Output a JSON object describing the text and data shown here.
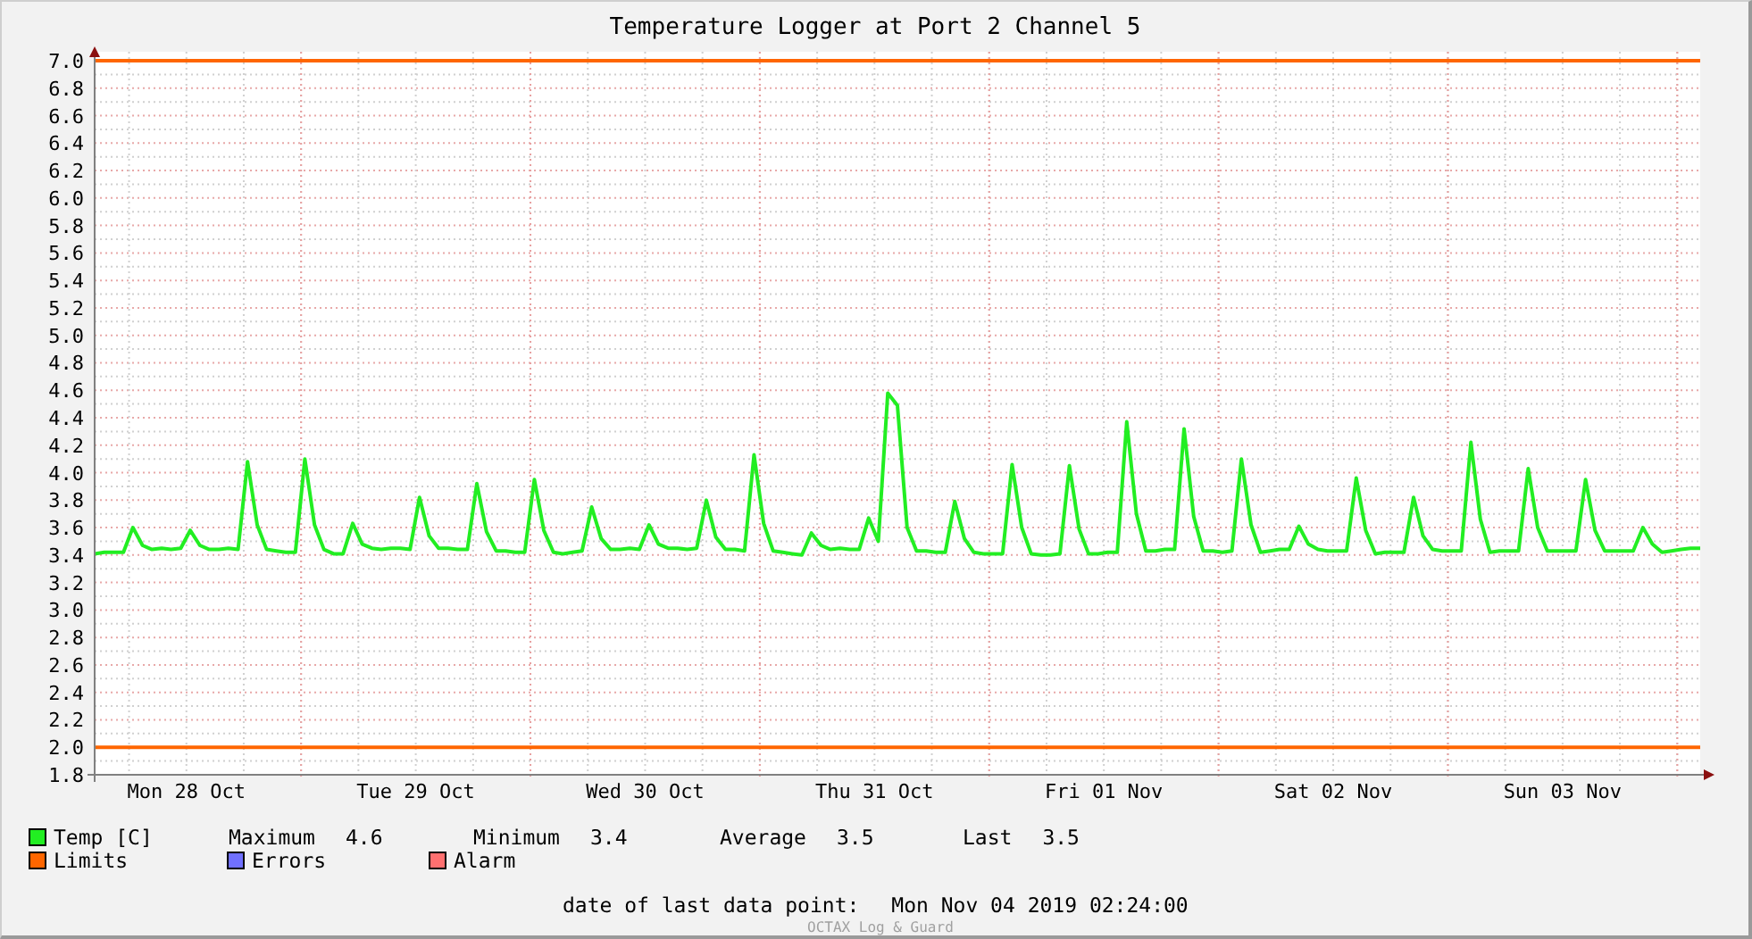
{
  "chart_data": {
    "type": "line",
    "title": "Temperature Logger at Port 2 Channel 5",
    "ylim": [
      1.8,
      7.0
    ],
    "categories": [
      null,
      null,
      null,
      null,
      null,
      null,
      null,
      null,
      null,
      null,
      "Mon 28 Oct",
      null,
      null,
      null,
      null,
      null,
      null,
      null,
      null,
      null,
      null,
      null,
      null,
      null,
      null,
      null,
      null,
      null,
      null,
      null,
      null,
      null,
      null,
      null,
      "Tue 29 Oct",
      null,
      null,
      null,
      null,
      null,
      null,
      null,
      null,
      null,
      null,
      null,
      null,
      null,
      null,
      null,
      null,
      null,
      null,
      null,
      null,
      null,
      null,
      null,
      "Wed 30 Oct",
      null,
      null,
      null,
      null,
      null,
      null,
      null,
      null,
      null,
      null,
      null,
      null,
      null,
      null,
      null,
      null,
      null,
      null,
      null,
      null,
      null,
      null,
      null,
      "Thu 31 Oct",
      null,
      null,
      null,
      null,
      null,
      null,
      null,
      null,
      null,
      null,
      null,
      null,
      null,
      null,
      null,
      null,
      null,
      null,
      null,
      null,
      null,
      null,
      null,
      "Fri 01 Nov",
      null,
      null,
      null,
      null,
      null,
      null,
      null,
      null,
      null,
      null,
      null,
      null,
      null,
      null,
      null,
      null,
      null,
      null,
      null,
      null,
      null,
      null,
      null,
      "Sat 02 Nov",
      null,
      null,
      null,
      null,
      null,
      null,
      null,
      null,
      null,
      null,
      null,
      null,
      null,
      null,
      null,
      null,
      null,
      null,
      null,
      null,
      null,
      null,
      null,
      "Sun 03 Nov",
      null,
      null,
      null,
      null,
      null,
      null,
      null,
      null,
      null,
      null,
      null,
      null,
      null,
      null
    ],
    "yticks": [
      {
        "value": 1.8,
        "label": "1.8"
      },
      {
        "value": 2,
        "label": "2.0"
      },
      {
        "value": 2.2,
        "label": "2.2"
      },
      {
        "value": 2.4,
        "label": "2.4"
      },
      {
        "value": 2.6,
        "label": "2.6"
      },
      {
        "value": 2.8,
        "label": "2.8"
      },
      {
        "value": 3,
        "label": "3.0"
      },
      {
        "value": 3.2,
        "label": "3.2"
      },
      {
        "value": 3.4,
        "label": "3.4"
      },
      {
        "value": 3.6,
        "label": "3.6"
      },
      {
        "value": 3.8,
        "label": "3.8"
      },
      {
        "value": 4,
        "label": "4.0"
      },
      {
        "value": 4.2,
        "label": "4.2"
      },
      {
        "value": 4.4,
        "label": "4.4"
      },
      {
        "value": 4.6,
        "label": "4.6"
      },
      {
        "value": 4.8,
        "label": "4.8"
      },
      {
        "value": 5,
        "label": "5.0"
      },
      {
        "value": 5.2,
        "label": "5.2"
      },
      {
        "value": 5.4,
        "label": "5.4"
      },
      {
        "value": 5.6,
        "label": "5.6"
      },
      {
        "value": 5.8,
        "label": "5.8"
      },
      {
        "value": 6,
        "label": "6.0"
      },
      {
        "value": 6.2,
        "label": "6.2"
      },
      {
        "value": 6.4,
        "label": "6.4"
      },
      {
        "value": 6.6,
        "label": "6.6"
      },
      {
        "value": 6.8,
        "label": "6.8"
      },
      {
        "value": 7,
        "label": "7.0"
      }
    ],
    "series": [
      {
        "name": "Temp [C]",
        "color": "#22ee22",
        "values": [
          3.41,
          3.42,
          3.42,
          3.42,
          3.6,
          3.47,
          3.44,
          3.45,
          3.44,
          3.45,
          3.58,
          3.47,
          3.44,
          3.44,
          3.45,
          3.44,
          4.08,
          3.62,
          3.44,
          3.43,
          3.42,
          3.42,
          4.1,
          3.62,
          3.44,
          3.41,
          3.41,
          3.63,
          3.48,
          3.45,
          3.44,
          3.45,
          3.45,
          3.44,
          3.82,
          3.54,
          3.45,
          3.45,
          3.44,
          3.44,
          3.92,
          3.57,
          3.43,
          3.43,
          3.42,
          3.42,
          3.95,
          3.58,
          3.42,
          3.41,
          3.42,
          3.43,
          3.75,
          3.52,
          3.44,
          3.44,
          3.45,
          3.44,
          3.62,
          3.48,
          3.45,
          3.45,
          3.44,
          3.45,
          3.8,
          3.53,
          3.44,
          3.44,
          3.43,
          4.13,
          3.63,
          3.43,
          3.42,
          3.41,
          3.4,
          3.56,
          3.47,
          3.44,
          3.45,
          3.44,
          3.44,
          3.67,
          3.5,
          4.58,
          4.49,
          3.6,
          3.43,
          3.43,
          3.42,
          3.42,
          3.79,
          3.52,
          3.42,
          3.41,
          3.41,
          3.41,
          4.06,
          3.6,
          3.41,
          3.4,
          3.4,
          3.41,
          4.05,
          3.59,
          3.41,
          3.41,
          3.42,
          3.42,
          4.37,
          3.7,
          3.43,
          3.43,
          3.44,
          3.44,
          4.32,
          3.68,
          3.43,
          3.43,
          3.42,
          3.43,
          4.1,
          3.62,
          3.42,
          3.43,
          3.44,
          3.44,
          3.61,
          3.48,
          3.44,
          3.43,
          3.43,
          3.43,
          3.96,
          3.58,
          3.41,
          3.42,
          3.42,
          3.42,
          3.82,
          3.54,
          3.44,
          3.43,
          3.43,
          3.43,
          4.22,
          3.66,
          3.42,
          3.43,
          3.43,
          3.43,
          4.03,
          3.6,
          3.43,
          3.43,
          3.43,
          3.43,
          3.95,
          3.58,
          3.43,
          3.43,
          3.43,
          3.43,
          3.6,
          3.48,
          3.42,
          3.43,
          3.44,
          3.45,
          3.45
        ]
      }
    ],
    "grid": true,
    "ref_lines": [
      {
        "axis": "y",
        "value": 7.0,
        "color": "#ff6600"
      },
      {
        "axis": "y",
        "value": 2.0,
        "color": "#ff6600"
      }
    ]
  },
  "legend": [
    {
      "label": "Limits",
      "color": "#ff6600"
    },
    {
      "label": "Errors",
      "color": "#7070ff"
    },
    {
      "label": "Alarm",
      "color": "#ff7070"
    }
  ],
  "stats": [
    {
      "label": "Maximum",
      "value": "4.6"
    },
    {
      "label": "Minimum",
      "value": "3.4"
    },
    {
      "label": "Average",
      "value": "3.5"
    },
    {
      "label": "Last",
      "value": "3.5"
    }
  ],
  "last_data_point": {
    "label": "date of last data point:",
    "value": "Mon Nov 04 2019 02:24:00"
  },
  "credit": "OCTAX Log & Guard"
}
